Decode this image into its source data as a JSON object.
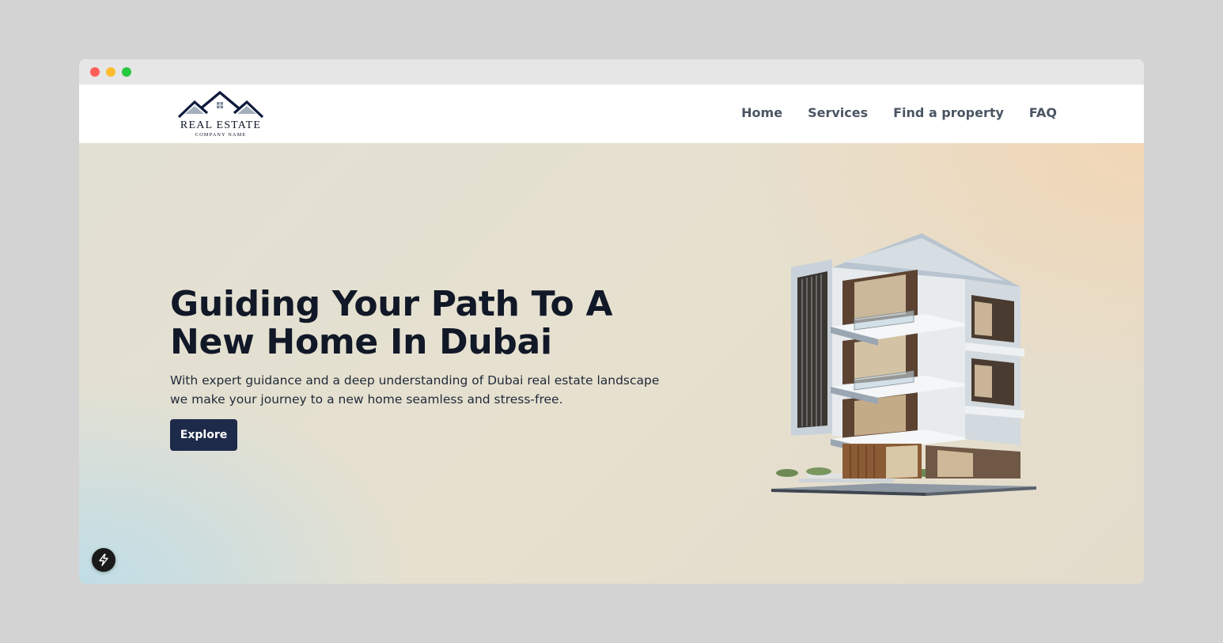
{
  "browser": {
    "controls": [
      "close",
      "minimize",
      "maximize"
    ]
  },
  "logo": {
    "title": "REAL ESTATE",
    "subtitle": "COMPANY NAME",
    "icon": "house-roofs-logo-icon"
  },
  "nav": {
    "items": [
      {
        "label": "Home"
      },
      {
        "label": "Services"
      },
      {
        "label": "Find a property"
      },
      {
        "label": "FAQ"
      }
    ]
  },
  "hero": {
    "heading_line1": "Guiding Your Path To A",
    "heading_line2": "New Home In Dubai",
    "description_line1": "With expert guidance and a deep understanding of Dubai real estate landscape",
    "description_line2": "we make your journey to a new home seamless and stress-free.",
    "cta_label": "Explore",
    "image": "modern-apartment-building-image"
  },
  "devtools": {
    "icon": "lightning-bolt-icon"
  },
  "colors": {
    "page_bg": "#d3d3d3",
    "button_bg": "#1e2a4a",
    "heading": "#111827",
    "nav_text": "#4b5563"
  }
}
